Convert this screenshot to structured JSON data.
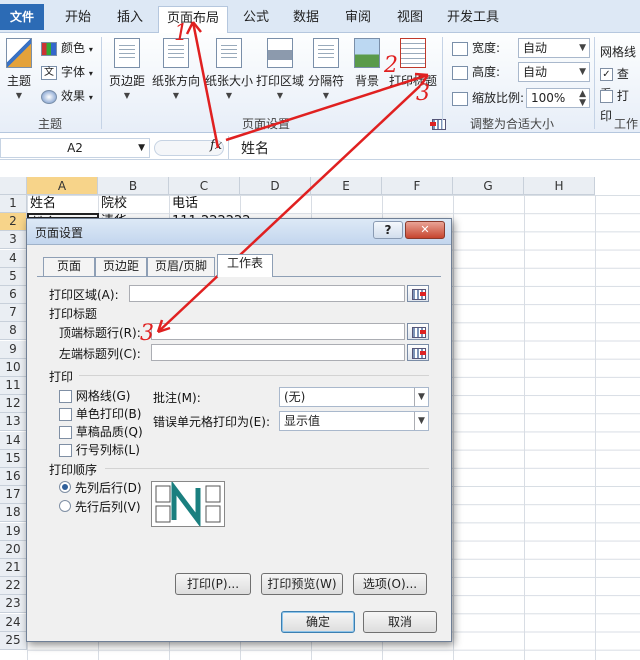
{
  "ribbon_tabs": {
    "file": "文件",
    "home": "开始",
    "insert": "插入",
    "page_layout": "页面布局",
    "formulas": "公式",
    "data": "数据",
    "review": "审阅",
    "view": "视图",
    "developer": "开发工具"
  },
  "ribbon": {
    "themes": "主题",
    "colors": "颜色",
    "fonts": "字体",
    "effects": "效果",
    "themes_group": "主题",
    "margins": "页边距",
    "orientation": "纸张方向",
    "size": "纸张大小",
    "print_area": "打印区域",
    "breaks": "分隔符",
    "background": "背景",
    "print_titles": "打印标题",
    "page_setup_group": "页面设置",
    "width_label": "宽度:",
    "width_value": "自动",
    "height_label": "高度:",
    "height_value": "自动",
    "scale_label": "缩放比例:",
    "scale_value": "100%",
    "scale_group": "调整为合适大小",
    "gridlines_label": "网格线",
    "view_label": "查看",
    "print_label": "打印",
    "sheet_options_group": "工作"
  },
  "formula_bar": {
    "name_box": "A2",
    "fx": "fx",
    "value": "姓名"
  },
  "sheet": {
    "columns": [
      "A",
      "B",
      "C",
      "D",
      "E",
      "F",
      "G",
      "H"
    ],
    "rows": [
      "1",
      "2",
      "3",
      "4",
      "5",
      "6",
      "7",
      "8",
      "9",
      "10",
      "11",
      "12",
      "13",
      "14",
      "15",
      "16",
      "17",
      "18",
      "19",
      "20",
      "21",
      "22",
      "23",
      "24",
      "25"
    ],
    "row1": [
      "姓名",
      "院校",
      "电话"
    ],
    "row2": [
      "姓名",
      "清华",
      "111 222222"
    ]
  },
  "dialog": {
    "title": "页面设置",
    "help": "?",
    "close": "✕",
    "tabs": [
      "页面",
      "页边距",
      "页眉/页脚",
      "工作表"
    ],
    "print_area_label": "打印区域(A):",
    "print_titles_section": "打印标题",
    "rows_to_repeat_label": "顶端标题行(R):",
    "cols_to_repeat_label": "左端标题列(C):",
    "print_section": "打印",
    "gridlines": "网格线(G)",
    "black_white": "单色打印(B)",
    "draft": "草稿品质(Q)",
    "headings": "行号列标(L)",
    "comments_label": "批注(M):",
    "comments_value": "(无)",
    "errors_label": "错误单元格打印为(E):",
    "errors_value": "显示值",
    "order_section": "打印顺序",
    "down_then_over": "先列后行(D)",
    "over_then_down": "先行后列(V)",
    "print_btn": "打印(P)...",
    "preview_btn": "打印预览(W)",
    "options_btn": "选项(O)...",
    "ok": "确定",
    "cancel": "取消"
  },
  "annotations": {
    "mark1": "1",
    "mark2": "2",
    "mark3": "3"
  },
  "colors": {
    "file_tab": "#2c6bb5",
    "arrow": "#e02020",
    "dialog_title": "#c3d6ee"
  }
}
